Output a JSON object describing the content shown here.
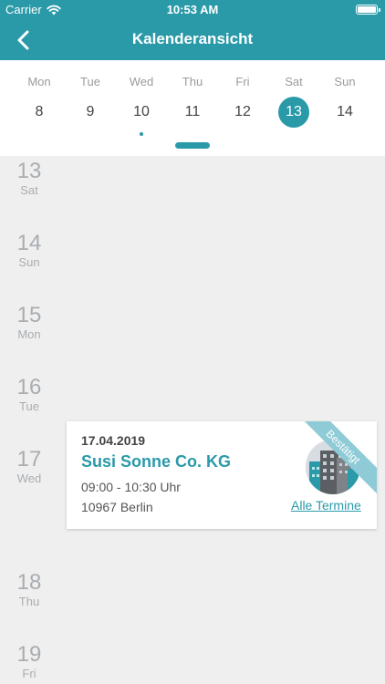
{
  "status_bar": {
    "carrier": "Carrier",
    "time": "10:53 AM"
  },
  "nav": {
    "title": "Kalenderansicht"
  },
  "week": {
    "days": [
      {
        "name": "Mon",
        "number": "8"
      },
      {
        "name": "Tue",
        "number": "9"
      },
      {
        "name": "Wed",
        "number": "10"
      },
      {
        "name": "Thu",
        "number": "11"
      },
      {
        "name": "Fri",
        "number": "12"
      },
      {
        "name": "Sat",
        "number": "13"
      },
      {
        "name": "Sun",
        "number": "14"
      }
    ],
    "selected_day": "13",
    "day_with_event_dot": "10"
  },
  "timeline": {
    "days": [
      {
        "number": "13",
        "name": "Sat"
      },
      {
        "number": "14",
        "name": "Sun"
      },
      {
        "number": "15",
        "name": "Mon"
      },
      {
        "number": "16",
        "name": "Tue"
      },
      {
        "number": "17",
        "name": "Wed"
      },
      {
        "number": "18",
        "name": "Thu"
      },
      {
        "number": "19",
        "name": "Fri"
      }
    ]
  },
  "appointment": {
    "date": "17.04.2019",
    "company": "Susi Sonne Co. KG",
    "time": "09:00 - 10:30 Uhr",
    "city": "10967 Berlin",
    "status": "Bestätigt",
    "link_label": "Alle Termine"
  },
  "colors": {
    "accent": "#2a9aa9",
    "ribbon": "#8ecbd6",
    "background": "#efefef"
  }
}
